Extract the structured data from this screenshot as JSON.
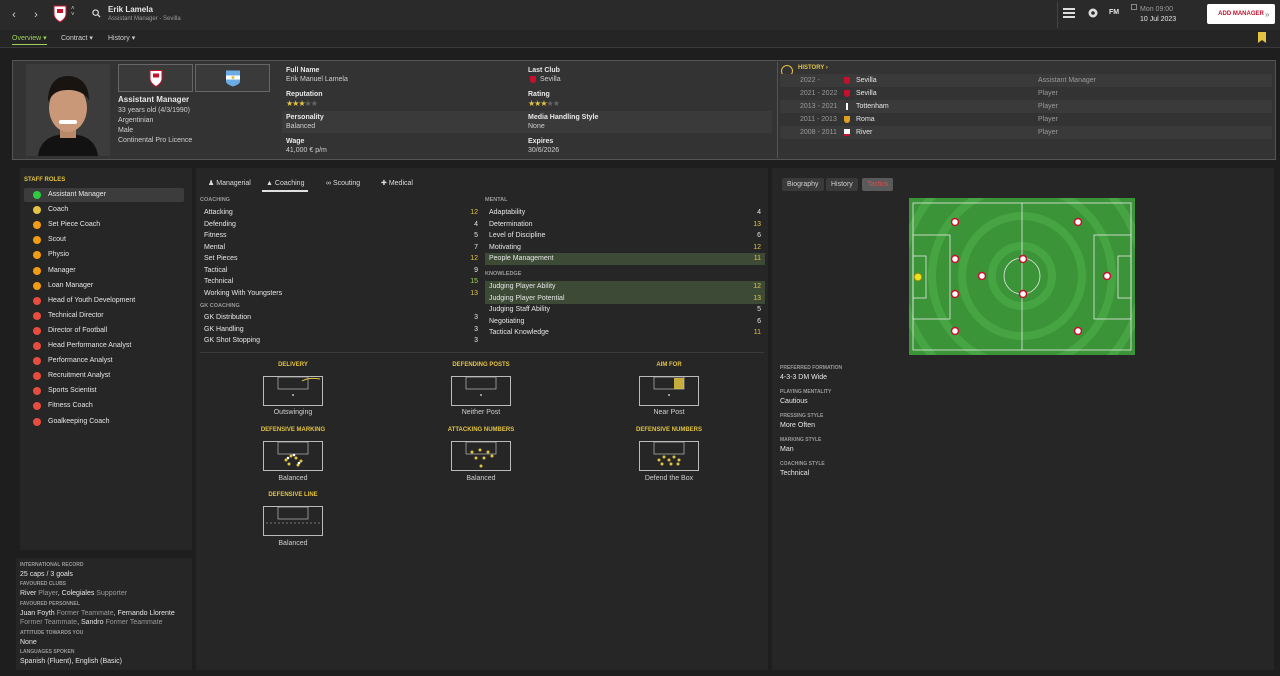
{
  "header": {
    "name": "Erik Lamela",
    "subtitle": "Assistant Manager - Sevilla",
    "datetime_day": "Mon 09:00",
    "datetime_date": "10 Jul 2023",
    "add_manager": "ADD MANAGER",
    "fm_label": "FM"
  },
  "subnav": {
    "overview": "Overview",
    "contract": "Contract",
    "history": "History"
  },
  "profile": {
    "role": "Assistant Manager",
    "age": "33 years old (4/3/1990)",
    "nationality": "Argentinian",
    "gender": "Male",
    "licence": "Continental Pro Licence",
    "full_name_label": "Full Name",
    "full_name": "Erik Manuel Lamela",
    "last_club_label": "Last Club",
    "last_club": "Sevilla",
    "reputation_label": "Reputation",
    "reputation_stars": 3,
    "rating_label": "Rating",
    "rating_stars": 3,
    "personality_label": "Personality",
    "personality": "Balanced",
    "media_label": "Media Handling Style",
    "media": "None",
    "wage_label": "Wage",
    "wage": "41,000 € p/m",
    "expires_label": "Expires",
    "expires": "30/6/2026"
  },
  "history": {
    "title": "HISTORY",
    "rows": [
      {
        "years": "2022 -",
        "club": "Sevilla",
        "role": "Assistant Manager"
      },
      {
        "years": "2021 - 2022",
        "club": "Sevilla",
        "role": "Player"
      },
      {
        "years": "2013 - 2021",
        "club": "Tottenham",
        "role": "Player"
      },
      {
        "years": "2011 - 2013",
        "club": "Roma",
        "role": "Player"
      },
      {
        "years": "2008 - 2011",
        "club": "River",
        "role": "Player"
      }
    ]
  },
  "staff_roles": {
    "title": "STAFF ROLES",
    "items": [
      {
        "label": "Assistant Manager",
        "color": "#2ecc40"
      },
      {
        "label": "Coach",
        "color": "#e3c342"
      },
      {
        "label": "Set Piece Coach",
        "color": "#f39c12"
      },
      {
        "label": "Scout",
        "color": "#f39c12"
      },
      {
        "label": "Physio",
        "color": "#f39c12"
      },
      {
        "label": "Manager",
        "color": "#f39c12"
      },
      {
        "label": "Loan Manager",
        "color": "#f39c12"
      },
      {
        "label": "Head of Youth Development",
        "color": "#e74c3c"
      },
      {
        "label": "Technical Director",
        "color": "#e74c3c"
      },
      {
        "label": "Director of Football",
        "color": "#e74c3c"
      },
      {
        "label": "Head Performance Analyst",
        "color": "#e74c3c"
      },
      {
        "label": "Performance Analyst",
        "color": "#e74c3c"
      },
      {
        "label": "Recruitment Analyst",
        "color": "#e74c3c"
      },
      {
        "label": "Sports Scientist",
        "color": "#e74c3c"
      },
      {
        "label": "Fitness Coach",
        "color": "#e74c3c"
      },
      {
        "label": "Goalkeeping Coach",
        "color": "#e74c3c"
      }
    ]
  },
  "info": {
    "intl_label": "INTERNATIONAL RECORD",
    "intl": "25 caps / 3 goals",
    "fav_clubs_label": "FAVOURED CLUBS",
    "fav_club_1": "River",
    "fav_club_1_role": "Player",
    "fav_club_2": "Colegiales",
    "fav_club_2_role": "Supporter",
    "fav_personnel_label": "FAVOURED PERSONNEL",
    "person_1": "Juan Foyth",
    "person_1_role": "Former Teammate",
    "person_2": "Fernando Llorente",
    "person_2_role": "Former Teammate",
    "person_3": "Sandro",
    "person_3_role": "Former Teammate",
    "attitude_label": "ATTITUDE TOWARDS YOU",
    "attitude": "None",
    "languages_label": "LANGUAGES SPOKEN",
    "languages": "Spanish (Fluent), English (Basic)"
  },
  "tabs": {
    "managerial": "Managerial",
    "coaching": "Coaching",
    "scouting": "Scouting",
    "medical": "Medical"
  },
  "coaching": {
    "title": "COACHING",
    "items": [
      {
        "label": "Attacking",
        "value": "12"
      },
      {
        "label": "Defending",
        "value": "4"
      },
      {
        "label": "Fitness",
        "value": "5"
      },
      {
        "label": "Mental",
        "value": "7"
      },
      {
        "label": "Set Pieces",
        "value": "12"
      },
      {
        "label": "Tactical",
        "value": "9"
      },
      {
        "label": "Technical",
        "value": "15"
      },
      {
        "label": "Working With Youngsters",
        "value": "13"
      }
    ]
  },
  "gk": {
    "title": "GK COACHING",
    "items": [
      {
        "label": "GK Distribution",
        "value": "3"
      },
      {
        "label": "GK Handling",
        "value": "3"
      },
      {
        "label": "GK Shot Stopping",
        "value": "3"
      }
    ]
  },
  "mental": {
    "title": "MENTAL",
    "items": [
      {
        "label": "Adaptability",
        "value": "4"
      },
      {
        "label": "Determination",
        "value": "13"
      },
      {
        "label": "Level of Discipline",
        "value": "6"
      },
      {
        "label": "Motivating",
        "value": "12"
      },
      {
        "label": "People Management",
        "value": "11"
      }
    ]
  },
  "knowledge": {
    "title": "KNOWLEDGE",
    "items": [
      {
        "label": "Judging Player Ability",
        "value": "12"
      },
      {
        "label": "Judging Player Potential",
        "value": "13"
      },
      {
        "label": "Judging Staff Ability",
        "value": "5"
      },
      {
        "label": "Negotiating",
        "value": "6"
      },
      {
        "label": "Tactical Knowledge",
        "value": "11"
      }
    ]
  },
  "set_pieces": {
    "delivery_title": "DELIVERY",
    "delivery": "Outswinging",
    "def_posts_title": "DEFENDING POSTS",
    "def_posts": "Neither Post",
    "aim_title": "AIM FOR",
    "aim": "Near Post",
    "def_marking_title": "DEFENSIVE MARKING",
    "def_marking": "Balanced",
    "att_numbers_title": "ATTACKING NUMBERS",
    "att_numbers": "Balanced",
    "def_numbers_title": "DEFENSIVE NUMBERS",
    "def_numbers": "Defend the Box",
    "def_line_title": "DEFENSIVE LINE",
    "def_line": "Balanced"
  },
  "right": {
    "tab_bio": "Biography",
    "tab_history": "History",
    "tab_tactics": "Tactics",
    "formation_label": "PREFERRED FORMATION",
    "formation": "4-3-3 DM Wide",
    "mentality_label": "PLAYING MENTALITY",
    "mentality": "Cautious",
    "pressing_label": "PRESSING STYLE",
    "pressing": "More Often",
    "marking_label": "MARKING STYLE",
    "marking": "Man",
    "coaching_style_label": "COACHING STYLE",
    "coaching_style": "Technical"
  },
  "colors": {
    "accent": "#e3c342",
    "brand_red": "#c8102e",
    "pitch": "#3f9a3b",
    "highlight": "#3d4b36"
  }
}
